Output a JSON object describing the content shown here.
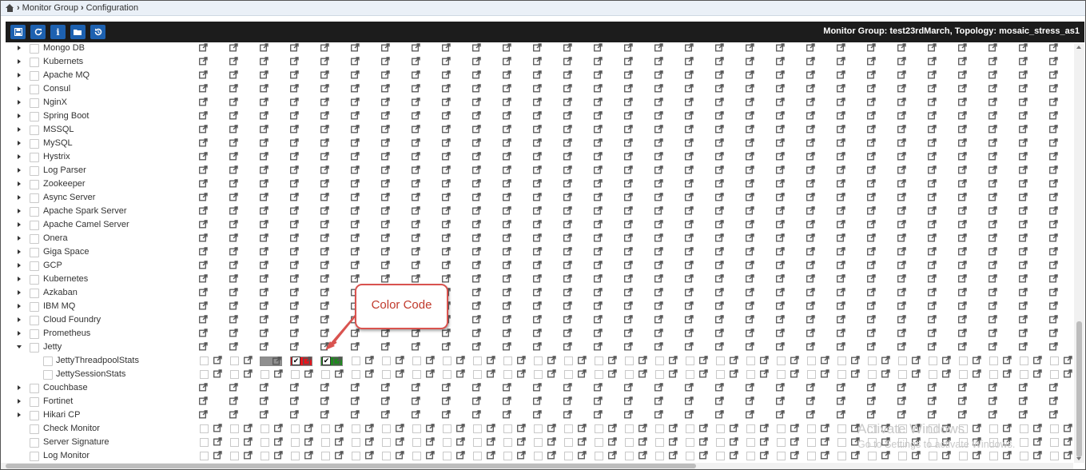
{
  "breadcrumb": {
    "items": [
      "Monitor Group",
      "Configuration"
    ]
  },
  "toolbar": {
    "buttons": [
      {
        "icon": "save-icon",
        "glyph": "💾"
      },
      {
        "icon": "refresh-icon",
        "glyph": "⟳"
      },
      {
        "icon": "info-icon",
        "glyph": "i"
      },
      {
        "icon": "folder-open-icon",
        "glyph": "▭"
      },
      {
        "icon": "history-icon",
        "glyph": "↺"
      }
    ],
    "info": "Monitor Group: test23rdMarch,  Topology: mosaic_stress_as1"
  },
  "rows": [
    {
      "label": "Mongo DB",
      "type": "group",
      "expanded": false
    },
    {
      "label": "Kubernets",
      "type": "group",
      "expanded": false
    },
    {
      "label": "Apache MQ",
      "type": "group",
      "expanded": false
    },
    {
      "label": "Consul",
      "type": "group",
      "expanded": false
    },
    {
      "label": "NginX",
      "type": "group",
      "expanded": false
    },
    {
      "label": "Spring Boot",
      "type": "group",
      "expanded": false
    },
    {
      "label": "MSSQL",
      "type": "group",
      "expanded": false
    },
    {
      "label": "MySQL",
      "type": "group",
      "expanded": false
    },
    {
      "label": "Hystrix",
      "type": "group",
      "expanded": false
    },
    {
      "label": "Log Parser",
      "type": "group",
      "expanded": false
    },
    {
      "label": "Zookeeper",
      "type": "group",
      "expanded": false
    },
    {
      "label": "Async Server",
      "type": "group",
      "expanded": false
    },
    {
      "label": "Apache Spark Server",
      "type": "group",
      "expanded": false
    },
    {
      "label": "Apache Camel Server",
      "type": "group",
      "expanded": false
    },
    {
      "label": "Onera",
      "type": "group",
      "expanded": false
    },
    {
      "label": "Giga Space",
      "type": "group",
      "expanded": false
    },
    {
      "label": "GCP",
      "type": "group",
      "expanded": false
    },
    {
      "label": "Kubernetes",
      "type": "group",
      "expanded": false
    },
    {
      "label": "Azkaban",
      "type": "group",
      "expanded": false
    },
    {
      "label": "IBM MQ",
      "type": "group",
      "expanded": false
    },
    {
      "label": "Cloud Foundry",
      "type": "group",
      "expanded": false
    },
    {
      "label": "Prometheus",
      "type": "group",
      "expanded": false
    },
    {
      "label": "Jetty",
      "type": "group",
      "expanded": true
    },
    {
      "label": "JettyThreadpoolStats",
      "type": "child"
    },
    {
      "label": "JettySessionStats",
      "type": "child"
    },
    {
      "label": "Couchbase",
      "type": "group",
      "expanded": false
    },
    {
      "label": "Fortinet",
      "type": "group",
      "expanded": false
    },
    {
      "label": "Hikari CP",
      "type": "group",
      "expanded": false
    },
    {
      "label": "Check Monitor",
      "type": "leaf"
    },
    {
      "label": "Server Signature",
      "type": "leaf"
    },
    {
      "label": "Log Monitor",
      "type": "leaf"
    }
  ],
  "color_codes": {
    "gray": "#8f8f8f",
    "red": "#e8141b",
    "green": "#1e8a1e"
  },
  "callout": {
    "text": "Color Code"
  },
  "watermark": {
    "line1": "Activate Windows",
    "line2": "Go to Settings to activate Windows."
  },
  "colors": {
    "toolbar_bg": "#1c1c1c",
    "button_bg": "#1d61b0",
    "breadcrumb_bg": "#eaf0f7",
    "callout_border": "#d9534f"
  }
}
